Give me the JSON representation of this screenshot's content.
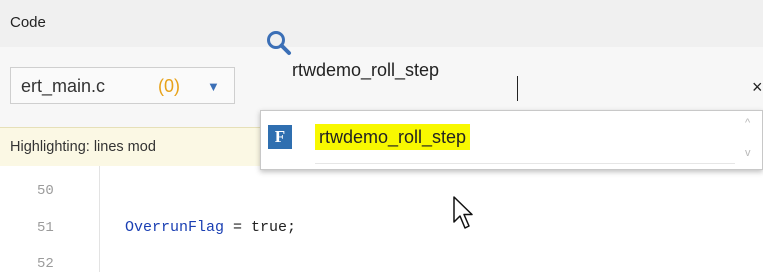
{
  "panel": {
    "title": "Code"
  },
  "file_selector": {
    "filename": "ert_main.c",
    "count": "(0)",
    "caret": "▼"
  },
  "search": {
    "value": "rtwdemo_roll_step",
    "clear": "×"
  },
  "highlight_bar": {
    "text": "Highlighting: lines mod"
  },
  "code": {
    "line_numbers": [
      "50",
      "51",
      "52"
    ],
    "line51": {
      "identifier": "OverrunFlag",
      "rest": " = true;"
    }
  },
  "autocomplete": {
    "icon_letter": "F",
    "result": "rtwdemo_roll_step",
    "scroll_up": "^",
    "scroll_down": "v"
  },
  "colors": {
    "count": "#e7a21a",
    "accent": "#3b6fb6",
    "match_highlight": "#f8f800",
    "function_icon": "#2f6fb0",
    "identifier": "#1a3fb3"
  },
  "icons": [
    "search-icon",
    "chevron-down-icon",
    "close-icon",
    "function-icon",
    "mouse-pointer-icon"
  ]
}
